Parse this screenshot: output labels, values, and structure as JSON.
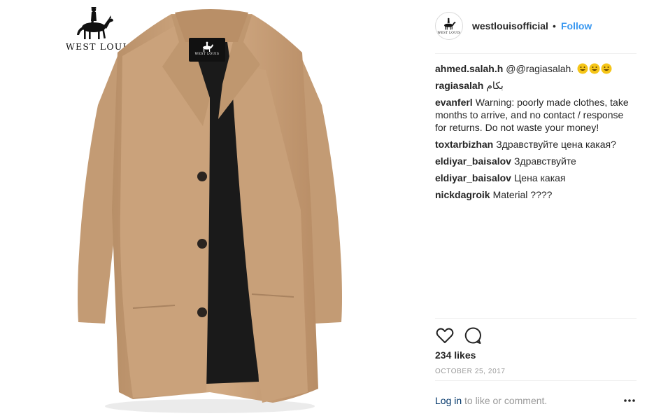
{
  "post": {
    "brand_logo_text": "WEST LOUIS",
    "label_logo_text": "WEST LOUIS"
  },
  "header": {
    "username": "westlouisofficial",
    "separator": "•",
    "follow_label": "Follow",
    "avatar_text": "WEST LOUIS"
  },
  "comments": [
    {
      "user": "ahmed.salah.h",
      "text": "@@ragiasalah."
    },
    {
      "user": "ragiasalah",
      "text": "بكام"
    },
    {
      "user": "evanferl",
      "text": "Warning: poorly made clothes, take months to arrive, and no contact / response for returns. Do not waste your money!"
    },
    {
      "user": "toxtarbizhan",
      "text": "Здравствуйте цена какая?"
    },
    {
      "user": "eldiyar_baisalov",
      "text": "Здравствуйте"
    },
    {
      "user": "eldiyar_baisalov",
      "text": "Цена какая"
    },
    {
      "user": "nickdagroik",
      "text": "Material ????"
    }
  ],
  "actions": {
    "like_icon": "heart-icon",
    "comment_icon": "comment-bubble-icon",
    "likes": "234 likes",
    "date": "OCTOBER 25, 2017"
  },
  "footer": {
    "login_link": "Log in",
    "login_rest": " to like or comment.",
    "more_icon": "more-options-icon"
  },
  "colors": {
    "accent": "#3897f0",
    "link": "#003569",
    "coat": "#c9a27c",
    "muted": "#999999"
  }
}
